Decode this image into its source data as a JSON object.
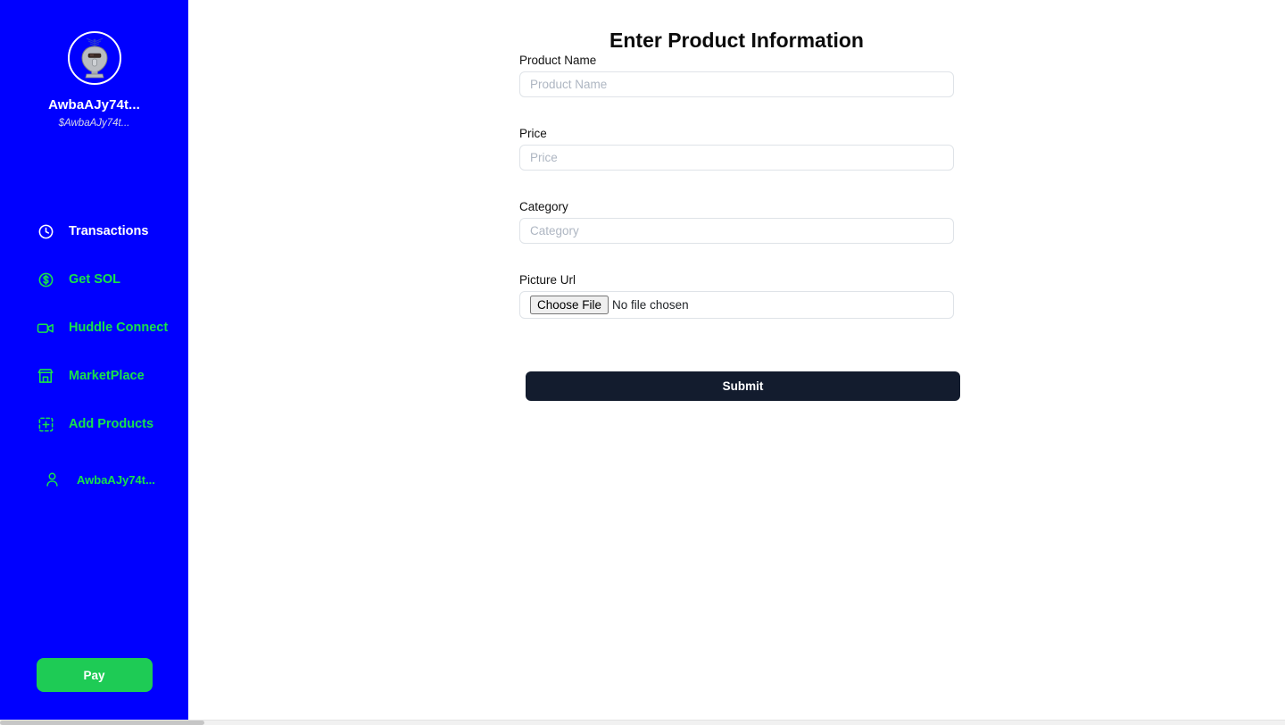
{
  "colors": {
    "sidebar_bg": "#0000ff",
    "accent_green": "#18e24a",
    "pay_green": "#1ecb55",
    "submit_dark": "#131c2e",
    "input_border": "#dfe3e8",
    "placeholder": "#aeb6c2"
  },
  "sidebar": {
    "brand": {
      "avatar_icon": "robot-avatar-icon",
      "name": "AwbaAJy74t...",
      "handle": "$AwbaAJy74t..."
    },
    "items": [
      {
        "label": "Transactions",
        "icon": "clock-icon",
        "accent": false
      },
      {
        "label": "Get SOL",
        "icon": "dollar-circle-icon",
        "accent": true
      },
      {
        "label": "Huddle Connect",
        "icon": "video-camera-icon",
        "accent": true
      },
      {
        "label": "MarketPlace",
        "icon": "store-icon",
        "accent": true
      },
      {
        "label": "Add Products",
        "icon": "add-square-icon",
        "accent": true
      }
    ],
    "user_item": {
      "label": "AwbaAJy74t...",
      "icon": "user-icon"
    },
    "pay_button": "Pay"
  },
  "main": {
    "title": "Enter Product Information",
    "fields": [
      {
        "label": "Product Name",
        "placeholder": "Product Name",
        "value": ""
      },
      {
        "label": "Price",
        "placeholder": "Price",
        "value": ""
      },
      {
        "label": "Category",
        "placeholder": "Category",
        "value": ""
      }
    ],
    "file_field": {
      "label": "Picture Url",
      "choose_button": "Choose File",
      "status": "No file chosen"
    },
    "submit_label": "Submit"
  },
  "scrollbar": {
    "orientation": "horizontal"
  }
}
